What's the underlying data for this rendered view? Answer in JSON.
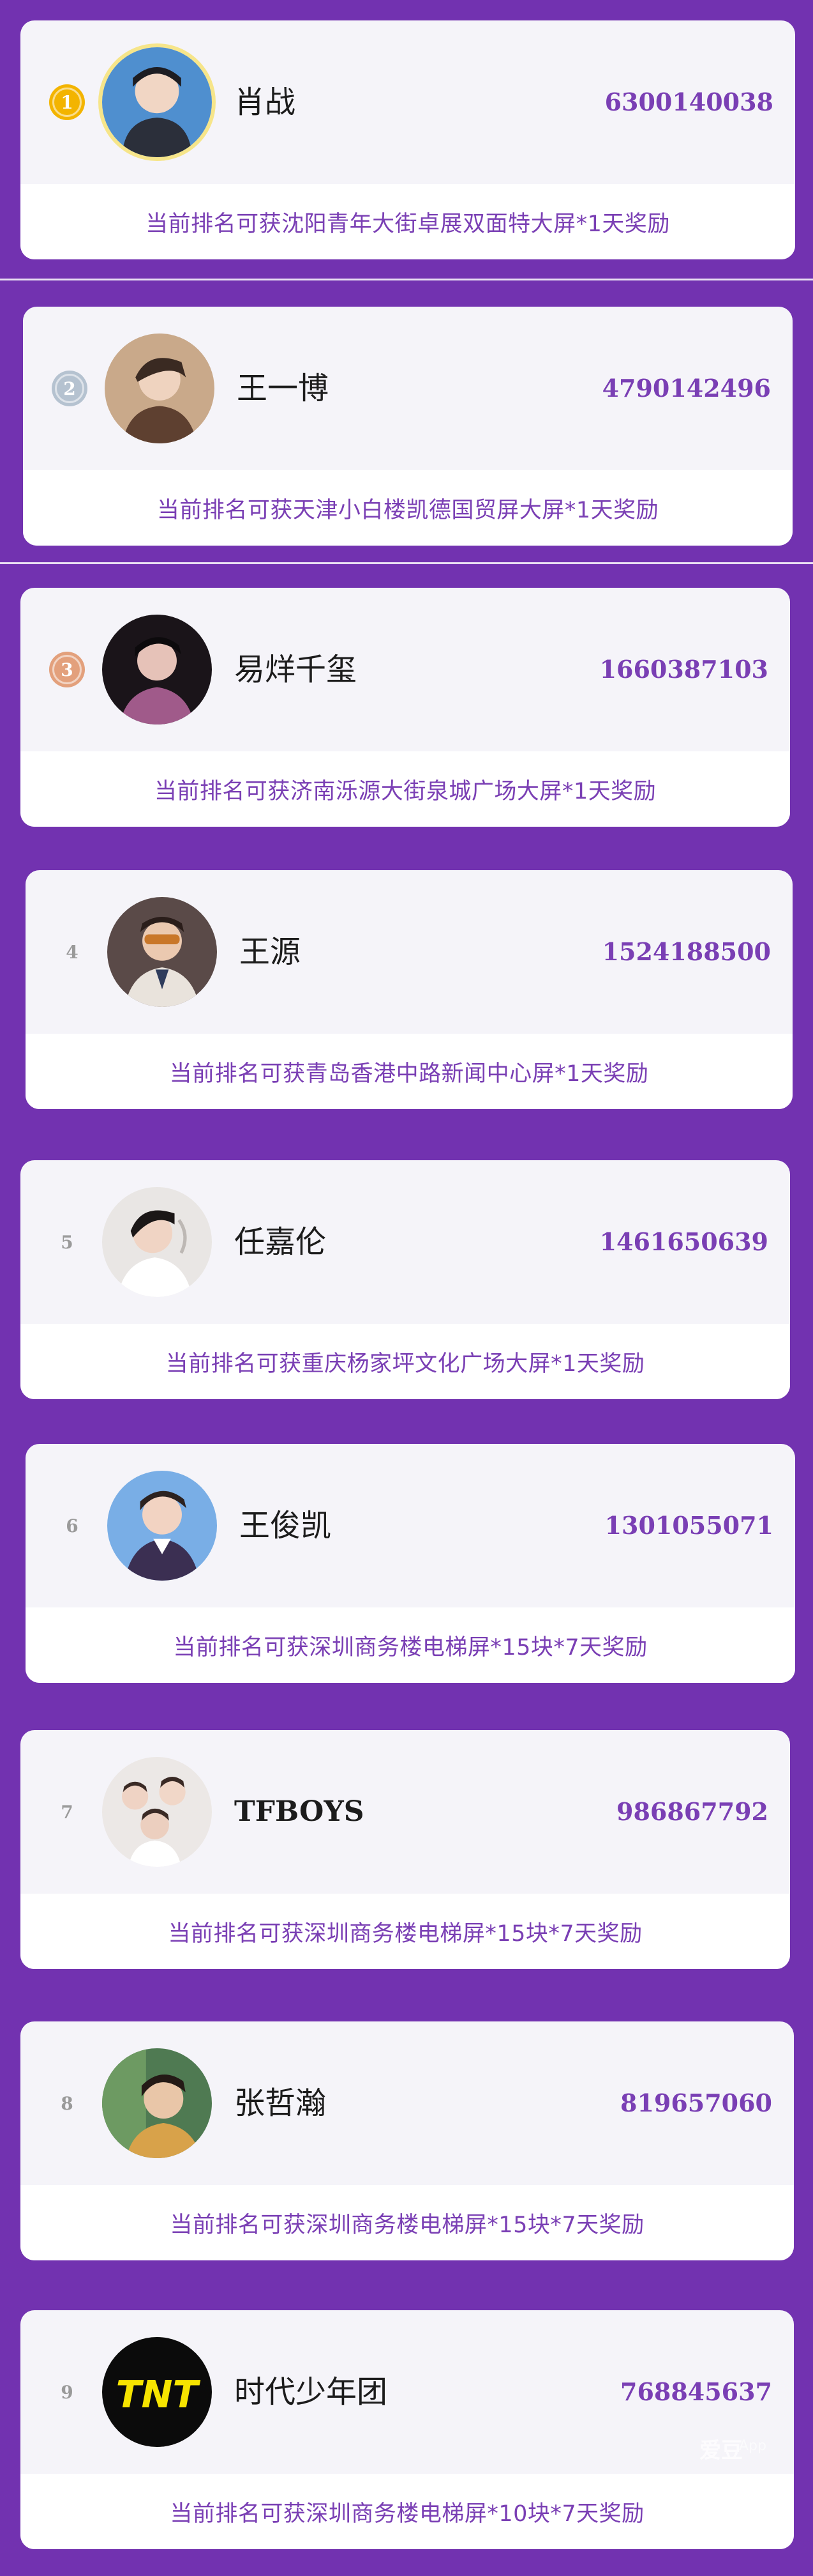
{
  "colors": {
    "background": "#7232b0",
    "card": "#f5f4f9",
    "accent_text": "#7a3fb4",
    "gold": "#f3b400",
    "silver": "#b5c2d0",
    "bronze": "#e3a07c"
  },
  "ranking": [
    {
      "rank": "1",
      "name": "肖战",
      "votes": "6300140038",
      "reward": "当前排名可获沈阳青年大街卓展双面特大屏*1天奖励",
      "medal": "gold"
    },
    {
      "rank": "2",
      "name": "王一博",
      "votes": "4790142496",
      "reward": "当前排名可获天津小白楼凯德国贸屏大屏*1天奖励",
      "medal": "silver"
    },
    {
      "rank": "3",
      "name": "易烊千玺",
      "votes": "1660387103",
      "reward": "当前排名可获济南泺源大街泉城广场大屏*1天奖励",
      "medal": "bronze"
    },
    {
      "rank": "4",
      "name": "王源",
      "votes": "1524188500",
      "reward": "当前排名可获青岛香港中路新闻中心屏*1天奖励",
      "medal": "none"
    },
    {
      "rank": "5",
      "name": "任嘉伦",
      "votes": "1461650639",
      "reward": "当前排名可获重庆杨家坪文化广场大屏*1天奖励",
      "medal": "none"
    },
    {
      "rank": "6",
      "name": "王俊凯",
      "votes": "1301055071",
      "reward": "当前排名可获深圳商务楼电梯屏*15块*7天奖励",
      "medal": "none"
    },
    {
      "rank": "7",
      "name": "TFBOYS",
      "votes": "986867792",
      "reward": "当前排名可获深圳商务楼电梯屏*15块*7天奖励",
      "medal": "none"
    },
    {
      "rank": "8",
      "name": "张哲瀚",
      "votes": "819657060",
      "reward": "当前排名可获深圳商务楼电梯屏*15块*7天奖励",
      "medal": "none"
    },
    {
      "rank": "9",
      "name": "时代少年团",
      "votes": "768845637",
      "reward": "当前排名可获深圳商务楼电梯屏*10块*7天奖励",
      "medal": "none",
      "logo_text": "TNT"
    }
  ],
  "watermark": {
    "main": "爱豆",
    "sub": "App"
  }
}
